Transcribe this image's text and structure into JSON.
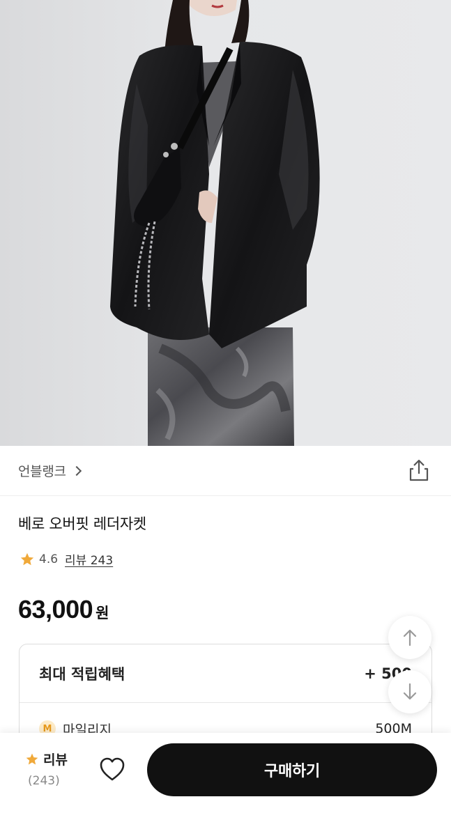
{
  "product_image": {
    "alt": ""
  },
  "brand": {
    "name": "언블랭크"
  },
  "icons": {
    "share": "share-icon",
    "star": "star-icon",
    "heart": "heart-icon",
    "chevron": "chevron-right-icon",
    "up": "arrow-up-icon",
    "down": "arrow-down-icon"
  },
  "product": {
    "title": "베로 오버핏 레더자켓",
    "rating": "4.6",
    "review_link": "리뷰 243",
    "price": "63,000",
    "currency": "원"
  },
  "benefits": {
    "title": "최대 적립혜택",
    "amount": "+ 500",
    "mileage_badge": "M",
    "mileage_label": "마일리지",
    "mileage_value": "500M"
  },
  "bottom_bar": {
    "review_label": "리뷰",
    "review_count": "(243)",
    "buy_label": "구매하기"
  },
  "colors": {
    "star": "#f0a93a",
    "buy_button": "#111111",
    "badge_bg": "#fdebc8",
    "badge_fg": "#e89a1c"
  }
}
